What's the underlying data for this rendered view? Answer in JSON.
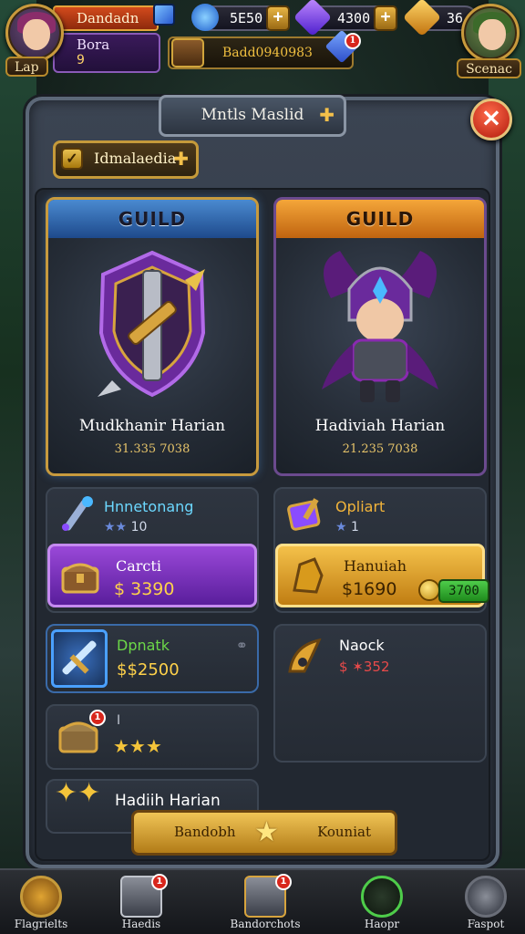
{
  "hud": {
    "player_name": "Dandadn",
    "player_rank": "Bora",
    "player_level": "9",
    "player_tag": "Lap",
    "resources": [
      {
        "name": "blue-orb",
        "value": "5E50",
        "color": "#3a8cff"
      },
      {
        "name": "purple-crystal",
        "value": "4300",
        "color": "#8a4cff"
      },
      {
        "name": "gold-gem",
        "value": "36",
        "color": "#f2a21e"
      }
    ],
    "mail_code": "Badd0940983",
    "mail_badge": "1",
    "opponent_tag": "Scenac"
  },
  "panel": {
    "title": "Mntls Maslid",
    "filter_label": "Idmalaedia",
    "close_label": "×",
    "guilds": [
      {
        "banner": "GUILD",
        "name": "Mudkhanir Harian",
        "sub": "31.335 7038"
      },
      {
        "banner": "GUILD",
        "name": "Hadiviah Harian",
        "sub": "21.235 7038"
      }
    ],
    "slots": {
      "hnnetonang": {
        "title": "Hnnetonang",
        "stars": "★★",
        "stars_count": "10",
        "btn_label": "Carcti",
        "btn_price": "$ 3390"
      },
      "opliart": {
        "title": "Opliart",
        "stars": "★",
        "stars_count": "1",
        "btn_label": "Hanuiah",
        "btn_price": "$1690",
        "pill_value": "3700"
      },
      "dpnak": {
        "title": "Dpnatk",
        "price": "$$2500"
      },
      "naock": {
        "title": "Naock",
        "price": "$ ✶352"
      },
      "chest": {
        "title": "I",
        "stars": "★★★",
        "badge": "1"
      },
      "hadiih": {
        "title": "Hadiih Harian"
      }
    },
    "bottom_left": "Bandobh",
    "bottom_right": "Kouniat"
  },
  "nav": [
    {
      "label": "Flagrielts",
      "icon": "guild-shield-icon",
      "badge": ""
    },
    {
      "label": "Haedis",
      "icon": "chest-icon",
      "badge": "1"
    },
    {
      "label": "Bandorchots",
      "icon": "treasure-chest-icon",
      "badge": "1"
    },
    {
      "label": "Haopr",
      "icon": "sword-icon",
      "badge": ""
    },
    {
      "label": "Faspot",
      "icon": "potion-icon",
      "badge": ""
    }
  ]
}
